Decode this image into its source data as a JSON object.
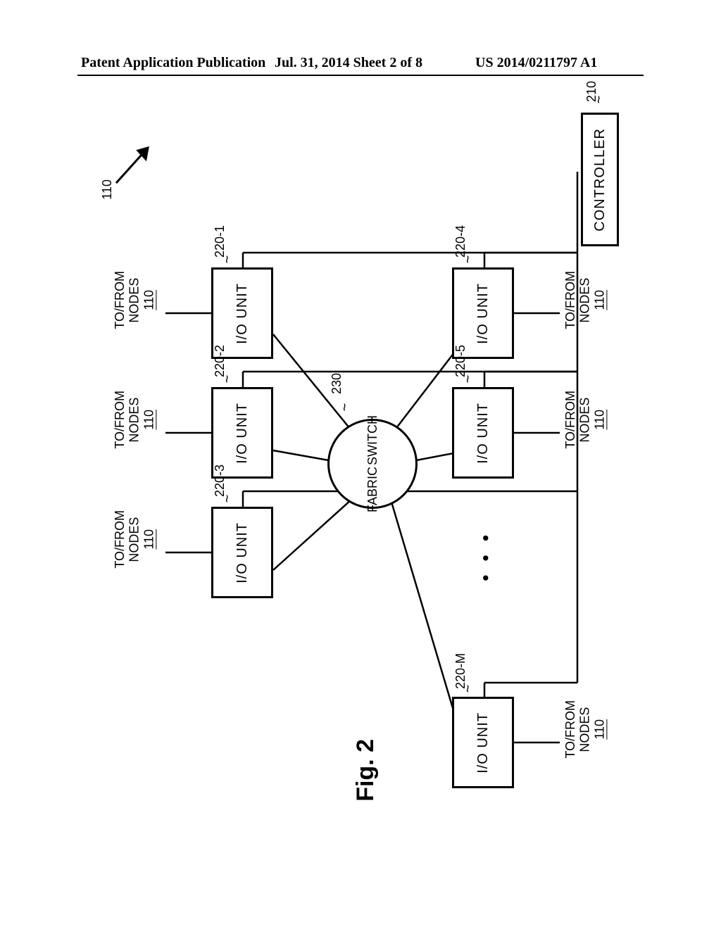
{
  "header": {
    "left": "Patent Application Publication",
    "center": "Jul. 31, 2014   Sheet 2 of 8",
    "right": "US 2014/0211797 A1"
  },
  "diagram": {
    "figure_caption": "Fig. 2",
    "system_ref": "110",
    "controller": {
      "label": "CONTROLLER",
      "ref": "210"
    },
    "switch_fabric": {
      "line1": "SWITCH",
      "line2": "FABRIC",
      "ref": "230"
    },
    "io_unit_label": "I/O UNIT",
    "io_refs": {
      "u1": "220-1",
      "u2": "220-2",
      "u3": "220-3",
      "u4": "220-4",
      "u5": "220-5",
      "um": "220-M"
    },
    "external": {
      "line1": "TO/FROM",
      "line2": "NODES",
      "ref": "110"
    },
    "ellipsis": "• • •"
  }
}
